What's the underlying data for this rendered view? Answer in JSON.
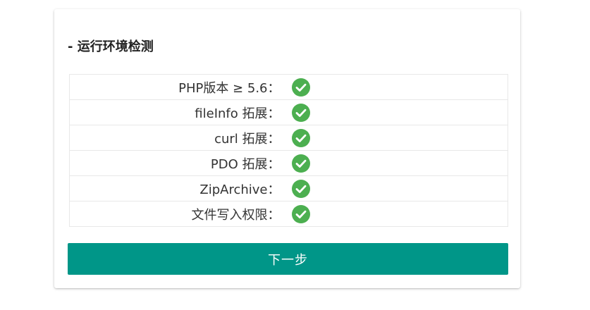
{
  "section": {
    "title": "- 运行环境检测"
  },
  "checks": [
    {
      "label": "PHP版本 ≥ 5.6：",
      "status": "ok",
      "icon": "check-circle-icon"
    },
    {
      "label": "fileInfo 拓展：",
      "status": "ok",
      "icon": "check-circle-icon"
    },
    {
      "label": "curl 拓展：",
      "status": "ok",
      "icon": "check-circle-icon"
    },
    {
      "label": "PDO 拓展：",
      "status": "ok",
      "icon": "check-circle-icon"
    },
    {
      "label": "ZipArchive：",
      "status": "ok",
      "icon": "check-circle-icon"
    },
    {
      "label": "文件写入权限：",
      "status": "ok",
      "icon": "check-circle-icon"
    }
  ],
  "next_button": {
    "label": "下一步"
  },
  "colors": {
    "accent": "#009688",
    "check": "#4caf50"
  }
}
